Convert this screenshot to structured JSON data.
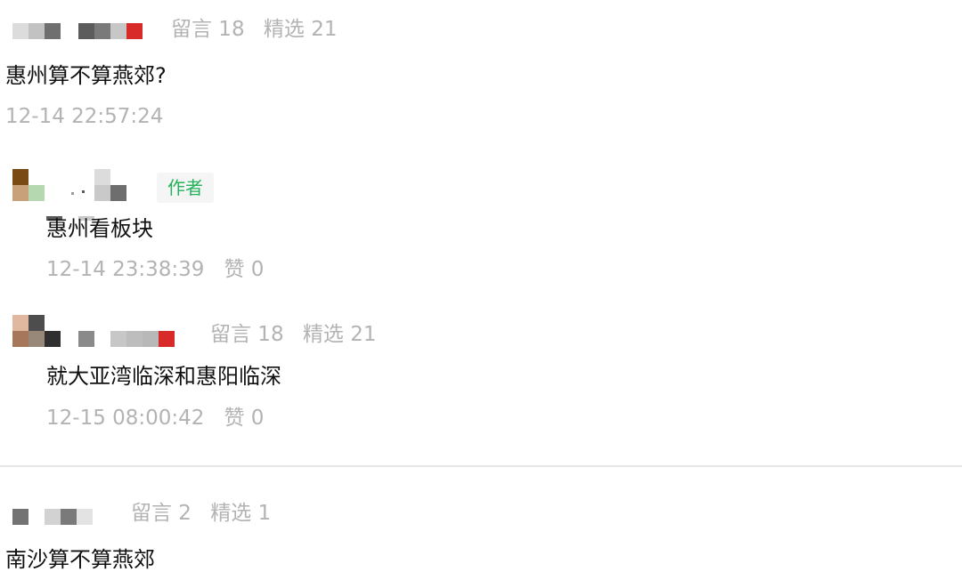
{
  "thread1": {
    "user_meta": {
      "messages": "留言 18",
      "featured": "精选 21"
    },
    "comment": "惠州算不算燕郊?",
    "time": "12-14 22:57:24",
    "replies": [
      {
        "badge": "作者",
        "text": "惠州看板块",
        "time": "12-14 23:38:39",
        "likes": "赞 0"
      },
      {
        "meta": {
          "messages": "留言 18",
          "featured": "精选 21"
        },
        "text": "就大亚湾临深和惠阳临深",
        "time": "12-15 08:00:42",
        "likes": "赞 0"
      }
    ]
  },
  "thread2": {
    "user_meta": {
      "messages": "留言 2",
      "featured": "精选 1"
    },
    "comment": "南沙算不算燕郊"
  },
  "colors": {
    "meta_gray": "#b3b3b3",
    "author_green": "#23b35b",
    "censor_red": "#d92a2a",
    "divider": "#e6e6e6"
  }
}
